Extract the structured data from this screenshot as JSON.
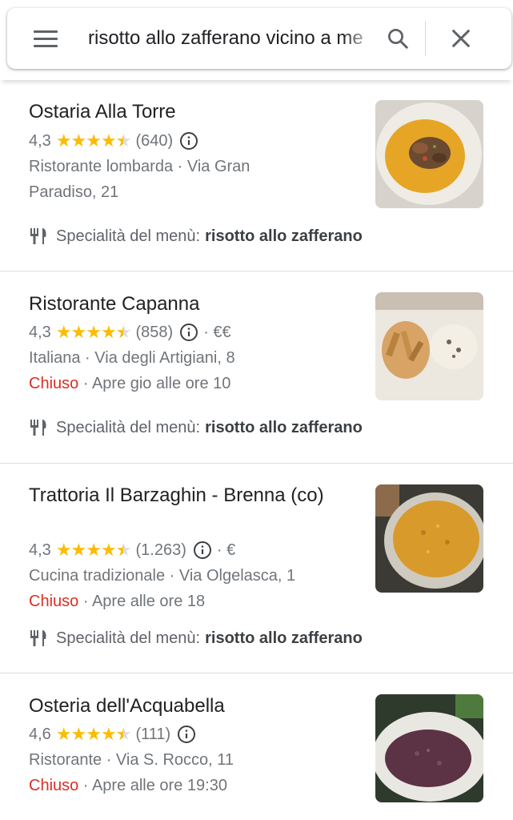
{
  "search": {
    "query": "risotto allo zafferano vicino a me"
  },
  "icons": {
    "menu": "hamburger-menu-icon",
    "search": "search-icon",
    "close": "close-icon",
    "info": "info-icon",
    "menu_specialty": "fork-knife-icon"
  },
  "colors": {
    "star": "#fbbc04",
    "closed": "#d93025",
    "secondary_text": "#70757a"
  },
  "results": [
    {
      "name": "Ostaria Alla Torre",
      "rating": "4,3",
      "stars": 4.3,
      "reviews": "(640)",
      "price": "",
      "category_line": "Ristorante lombarda · Via Gran",
      "address_cont": "Paradiso, 21",
      "status": "",
      "hours": "",
      "menu_label": "Specialità del menù:",
      "menu_item": "risotto allo zafferano"
    },
    {
      "name": "Ristorante Capanna",
      "rating": "4,3",
      "stars": 4.3,
      "reviews": "(858)",
      "price": "· €€",
      "category_line": "Italiana · Via degli Artigiani, 8",
      "status": "Chiuso",
      "hours": "· Apre gio alle ore 10",
      "menu_label": "Specialità del menù:",
      "menu_item": "risotto allo zafferano"
    },
    {
      "name": "Trattoria Il Barzaghin - Brenna (co)",
      "rating": "4,3",
      "stars": 4.3,
      "reviews": "(1.263)",
      "price": "· €",
      "category_line": "Cucina tradizionale · Via Olgelasca, 1",
      "status": "Chiuso",
      "hours": "· Apre alle ore 18",
      "menu_label": "Specialità del menù:",
      "menu_item": "risotto allo zafferano"
    },
    {
      "name": "Osteria dell'Acquabella",
      "rating": "4,6",
      "stars": 4.6,
      "reviews": "(111)",
      "price": "",
      "category_line": "Ristorante · Via S. Rocco, 11",
      "status": "Chiuso",
      "hours": "· Apre alle ore 19:30"
    }
  ]
}
